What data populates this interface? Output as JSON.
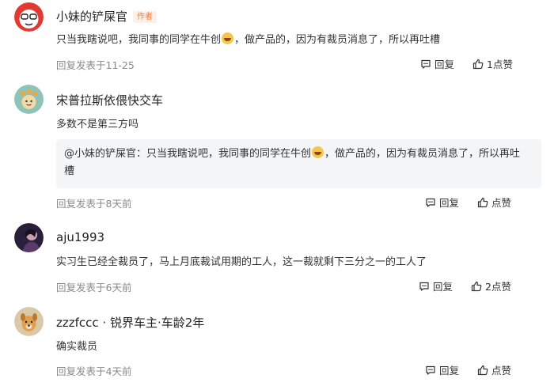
{
  "comments": [
    {
      "author": "小妹的铲屎官",
      "badge": "作者",
      "text_before_emoji": "只当我瞎说吧，我同事的同学在牛创",
      "text_after_emoji": "，做产品的，因为有裁员消息了，所以再吐槽",
      "meta": "回复发表于11-25",
      "reply_label": "回复",
      "like_label": "1点赞"
    },
    {
      "author": "宋普拉斯依偎快交车",
      "text": "多数不是第三方吗",
      "quote_line1_before": "@小妹的铲屎官：只当我瞎说吧，我同事的同学在牛创",
      "quote_line1_after": "，做产品的，因为有裁员消息了，所以再吐",
      "quote_line2": "槽",
      "meta": "回复发表于8天前",
      "reply_label": "回复",
      "like_label": "点赞"
    },
    {
      "author": "aju1993",
      "text": "实习生已经全裁员了，马上月底裁试用期的工人，这一裁就剩下三分之一的工人了",
      "meta": "回复发表于6天前",
      "reply_label": "回复",
      "like_label": "2点赞"
    },
    {
      "author": "zzzfccc · 锐界车主·车龄2年",
      "text": "确实裁员",
      "meta": "回复发表于4天前",
      "reply_label": "回复",
      "like_label": "点赞"
    }
  ],
  "colors": {
    "badge_bg": "#fdf0e8",
    "badge_text": "#f07a3a",
    "meta_text": "#8a8a8a",
    "quote_bg": "#f4f5f7"
  },
  "icons": {
    "reply": "comment-bubble-icon",
    "like": "thumbs-up-icon"
  }
}
